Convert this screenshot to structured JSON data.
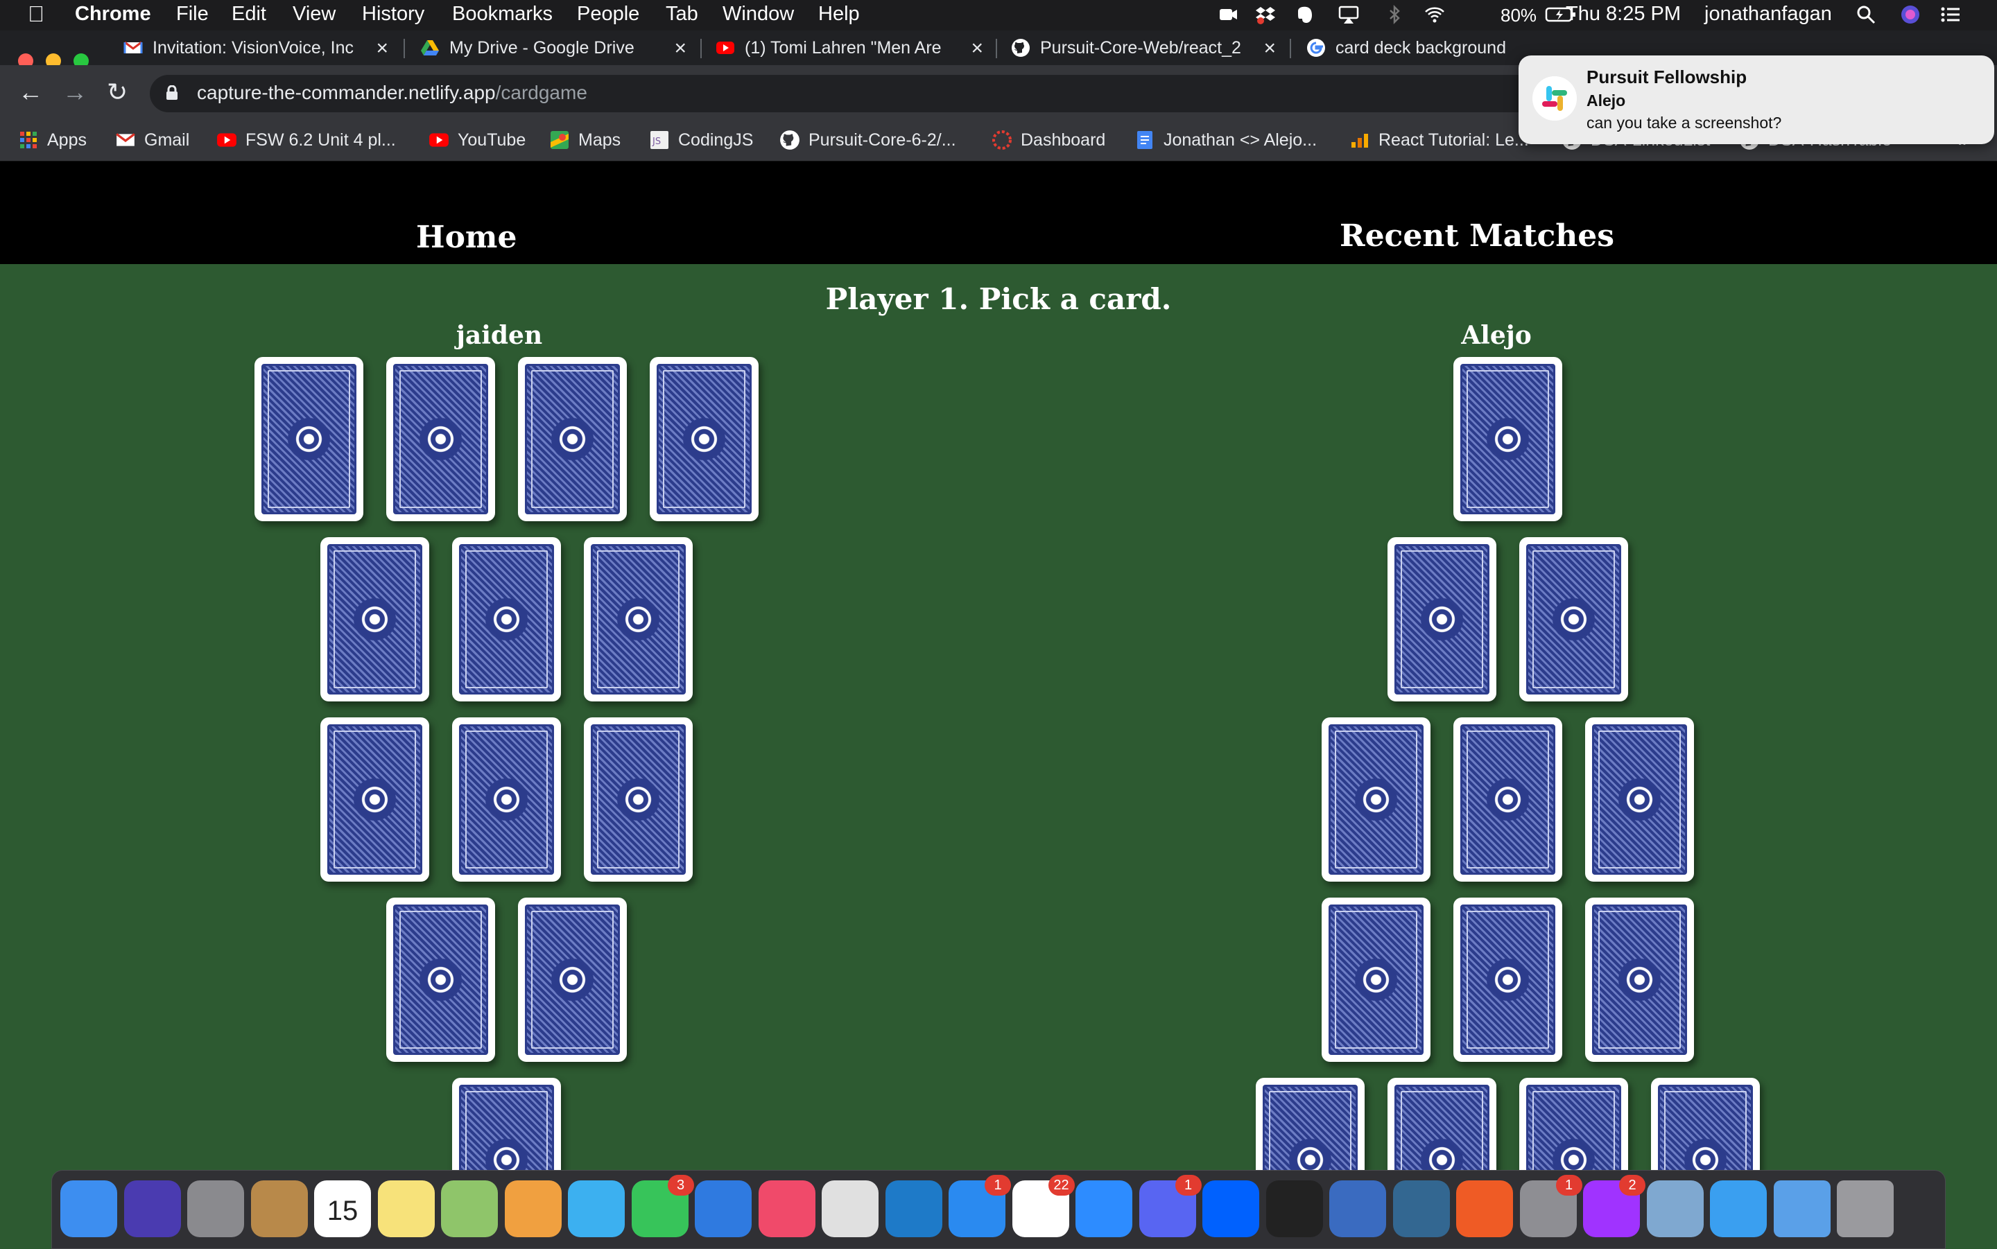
{
  "menubar": {
    "app": "Chrome",
    "menus": [
      "File",
      "Edit",
      "View",
      "History",
      "Bookmarks",
      "People",
      "Tab",
      "Window",
      "Help"
    ],
    "battery": "80%",
    "clock": "Thu 8:25 PM",
    "user": "jonathanfagan"
  },
  "tabs": [
    {
      "title": "Invitation: VisionVoice, Inc",
      "icon": "gmail-icon"
    },
    {
      "title": "My Drive - Google Drive",
      "icon": "drive-icon"
    },
    {
      "title": "(1) Tomi Lahren \"Men Are",
      "icon": "youtube-icon"
    },
    {
      "title": "Pursuit-Core-Web/react_2",
      "icon": "github-icon"
    },
    {
      "title": "card deck background",
      "icon": "google-icon"
    }
  ],
  "omnibox": {
    "host": "capture-the-commander.netlify.app",
    "path": "/cardgame"
  },
  "bookmarks": [
    {
      "label": "Apps",
      "icon": "apps-grid-icon"
    },
    {
      "label": "Gmail",
      "icon": "gmail-icon"
    },
    {
      "label": "FSW 6.2 Unit 4 pl...",
      "icon": "youtube-icon"
    },
    {
      "label": "YouTube",
      "icon": "youtube-icon"
    },
    {
      "label": "Maps",
      "icon": "maps-icon"
    },
    {
      "label": "CodingJS",
      "icon": "codingjs-icon"
    },
    {
      "label": "Pursuit-Core-6-2/...",
      "icon": "github-icon"
    },
    {
      "label": "Dashboard",
      "icon": "dashboard-icon"
    },
    {
      "label": "Jonathan <> Alejo...",
      "icon": "docs-icon"
    },
    {
      "label": "React Tutorial: Le...",
      "icon": "chart-icon"
    },
    {
      "label": "DSA-LinkedList",
      "icon": "github-icon"
    },
    {
      "label": "DSA-HashTable",
      "icon": "github-icon"
    }
  ],
  "bookmarks_more": "»",
  "notification": {
    "app": "Pursuit Fellowship",
    "sender": "Alejo",
    "message": "can you take a screenshot?"
  },
  "page": {
    "nav": {
      "home": "Home",
      "recent": "Recent Matches"
    },
    "prompt": "Player 1. Pick a card.",
    "player_left": "jaiden",
    "player_right": "Alejo",
    "left_rows": [
      4,
      3,
      3,
      2,
      1
    ],
    "right_rows": [
      1,
      2,
      3,
      3,
      4
    ]
  },
  "colors": {
    "felt": "#2d5a31",
    "card_back": "#2c3c8c",
    "navbar": "#000000"
  },
  "dock": {
    "apps": [
      {
        "name": "finder",
        "color": "#3d8ef0",
        "badge": ""
      },
      {
        "name": "siri",
        "color": "#4a3bb0",
        "badge": ""
      },
      {
        "name": "launchpad",
        "color": "#8a8a8e",
        "badge": ""
      },
      {
        "name": "contacts",
        "color": "#b8894a",
        "badge": ""
      },
      {
        "name": "calendar",
        "color": "#ffffff",
        "badge": "",
        "text": "15"
      },
      {
        "name": "notes",
        "color": "#f7e27a",
        "badge": ""
      },
      {
        "name": "maps",
        "color": "#8fc56a",
        "badge": ""
      },
      {
        "name": "photos",
        "color": "#f0a040",
        "badge": ""
      },
      {
        "name": "messages",
        "color": "#3cb0f0",
        "badge": ""
      },
      {
        "name": "facetime",
        "color": "#37c45a",
        "badge": "3"
      },
      {
        "name": "keynote",
        "color": "#2f7ae0",
        "badge": ""
      },
      {
        "name": "music",
        "color": "#f04a6a",
        "badge": ""
      },
      {
        "name": "chrome",
        "color": "#e0e0e0",
        "badge": ""
      },
      {
        "name": "vscode",
        "color": "#1e7ac8",
        "badge": ""
      },
      {
        "name": "app-store",
        "color": "#2a8af0",
        "badge": "1"
      },
      {
        "name": "slack",
        "color": "#ffffff",
        "badge": "22"
      },
      {
        "name": "zoom",
        "color": "#2d8cff",
        "badge": ""
      },
      {
        "name": "discord",
        "color": "#5865f2",
        "badge": "1"
      },
      {
        "name": "dropbox",
        "color": "#0061fe",
        "badge": ""
      },
      {
        "name": "terminal",
        "color": "#222222",
        "badge": ""
      },
      {
        "name": "tableplus",
        "color": "#3a6bc0",
        "badge": ""
      },
      {
        "name": "postgres",
        "color": "#336791",
        "badge": ""
      },
      {
        "name": "postman",
        "color": "#ef5b25",
        "badge": ""
      },
      {
        "name": "system-preferences",
        "color": "#8e8e93",
        "badge": "1"
      },
      {
        "name": "messenger",
        "color": "#a033ff",
        "badge": "2"
      },
      {
        "name": "preview",
        "color": "#7fa8d0",
        "badge": ""
      },
      {
        "name": "safari",
        "color": "#3a9ff0",
        "badge": ""
      },
      {
        "name": "downloads",
        "color": "#5aa0e8",
        "badge": ""
      },
      {
        "name": "trash",
        "color": "#9a9a9e",
        "badge": ""
      }
    ]
  }
}
